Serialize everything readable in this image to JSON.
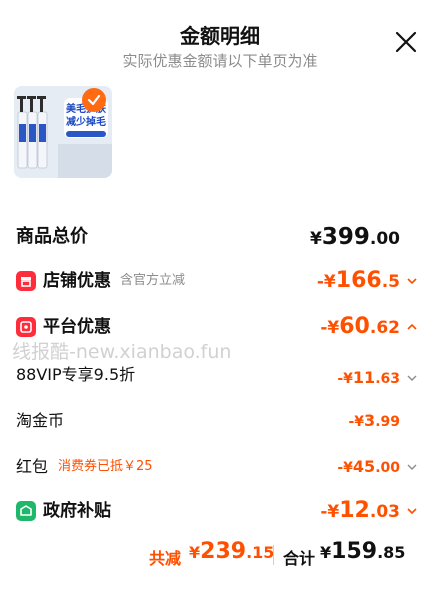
{
  "header": {
    "title": "金额明细",
    "subtitle": "实际优惠金额请以下单页为准"
  },
  "product": {
    "image_text_line1": "美毛护肤",
    "image_text_line2": "减少掉毛"
  },
  "rows": {
    "total": {
      "label": "商品总价",
      "currency": "¥",
      "int": "399",
      "dec": ".00"
    },
    "store": {
      "label": "店铺优惠",
      "tag": "含官方立减",
      "prefix": "-¥",
      "int": "166",
      "dec": ".5"
    },
    "platform": {
      "label": "平台优惠",
      "prefix": "-¥",
      "int": "60",
      "dec": ".62"
    },
    "vip": {
      "label": "88VIP专享9.5折",
      "prefix": "-¥",
      "int": "11",
      "dec": ".63"
    },
    "coin": {
      "label": "淘金币",
      "prefix": "-¥",
      "int": "3",
      "dec": ".99"
    },
    "redpack": {
      "label": "红包",
      "tag": "消费券已抵￥25",
      "prefix": "-¥",
      "int": "45",
      "dec": ".00"
    },
    "subsidy": {
      "label": "政府补贴",
      "prefix": "-¥",
      "int": "12",
      "dec": ".03"
    }
  },
  "footer": {
    "saved_label": "共减",
    "saved_currency": "¥",
    "saved_int": "239",
    "saved_dec": ".15",
    "total_label": "合计",
    "total_currency": "¥",
    "total_int": "159",
    "total_dec": ".85"
  },
  "watermark": "线报酷-new.xianbao.fun",
  "colors": {
    "accent": "#ff5000",
    "icon_red": "#ff2d3b",
    "icon_green": "#1fb86b"
  }
}
